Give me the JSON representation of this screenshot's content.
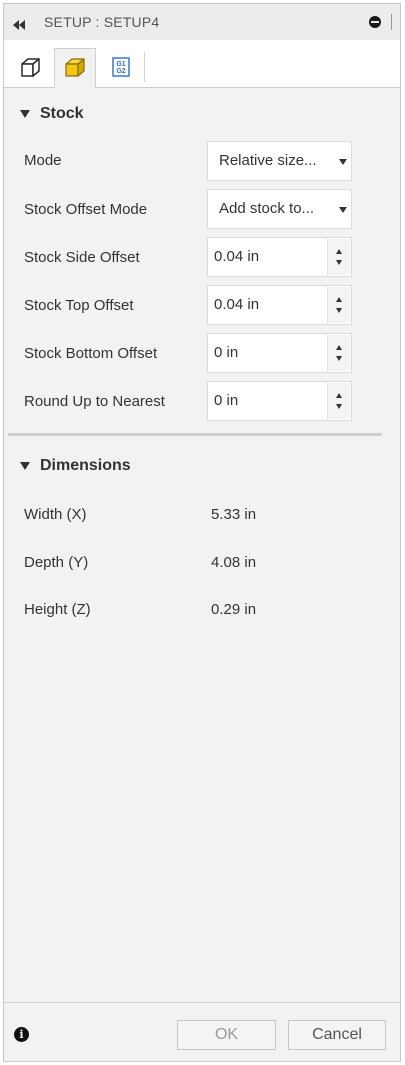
{
  "window": {
    "title": "SETUP : SETUP4"
  },
  "tabs": [
    {
      "icon": "setup-box-outline-icon"
    },
    {
      "icon": "stock-box-yellow-icon"
    },
    {
      "icon": "g1-g2-icon",
      "label": "G1\nG2"
    }
  ],
  "stock": {
    "header": "Stock",
    "mode": {
      "label": "Mode",
      "value": "Relative size..."
    },
    "offset_mode": {
      "label": "Stock Offset Mode",
      "value": "Add stock to..."
    },
    "side_offset": {
      "label": "Stock Side Offset",
      "value": "0.04 in"
    },
    "top_offset": {
      "label": "Stock Top Offset",
      "value": "0.04 in"
    },
    "bottom_offset": {
      "label": "Stock Bottom Offset",
      "value": "0 in"
    },
    "round_up": {
      "label": "Round Up to Nearest",
      "value": "0 in"
    }
  },
  "dimensions": {
    "header": "Dimensions",
    "width": {
      "label": "Width (X)",
      "value": "5.33 in"
    },
    "depth": {
      "label": "Depth (Y)",
      "value": "4.08 in"
    },
    "height": {
      "label": "Height (Z)",
      "value": "0.29 in"
    }
  },
  "footer": {
    "ok_label": "OK",
    "cancel_label": "Cancel",
    "info": "i"
  },
  "colors": {
    "stock_yellow": "#f3c614",
    "g_icon_blue": "#2a6fc9",
    "panel_bg": "#f2f2f2"
  }
}
